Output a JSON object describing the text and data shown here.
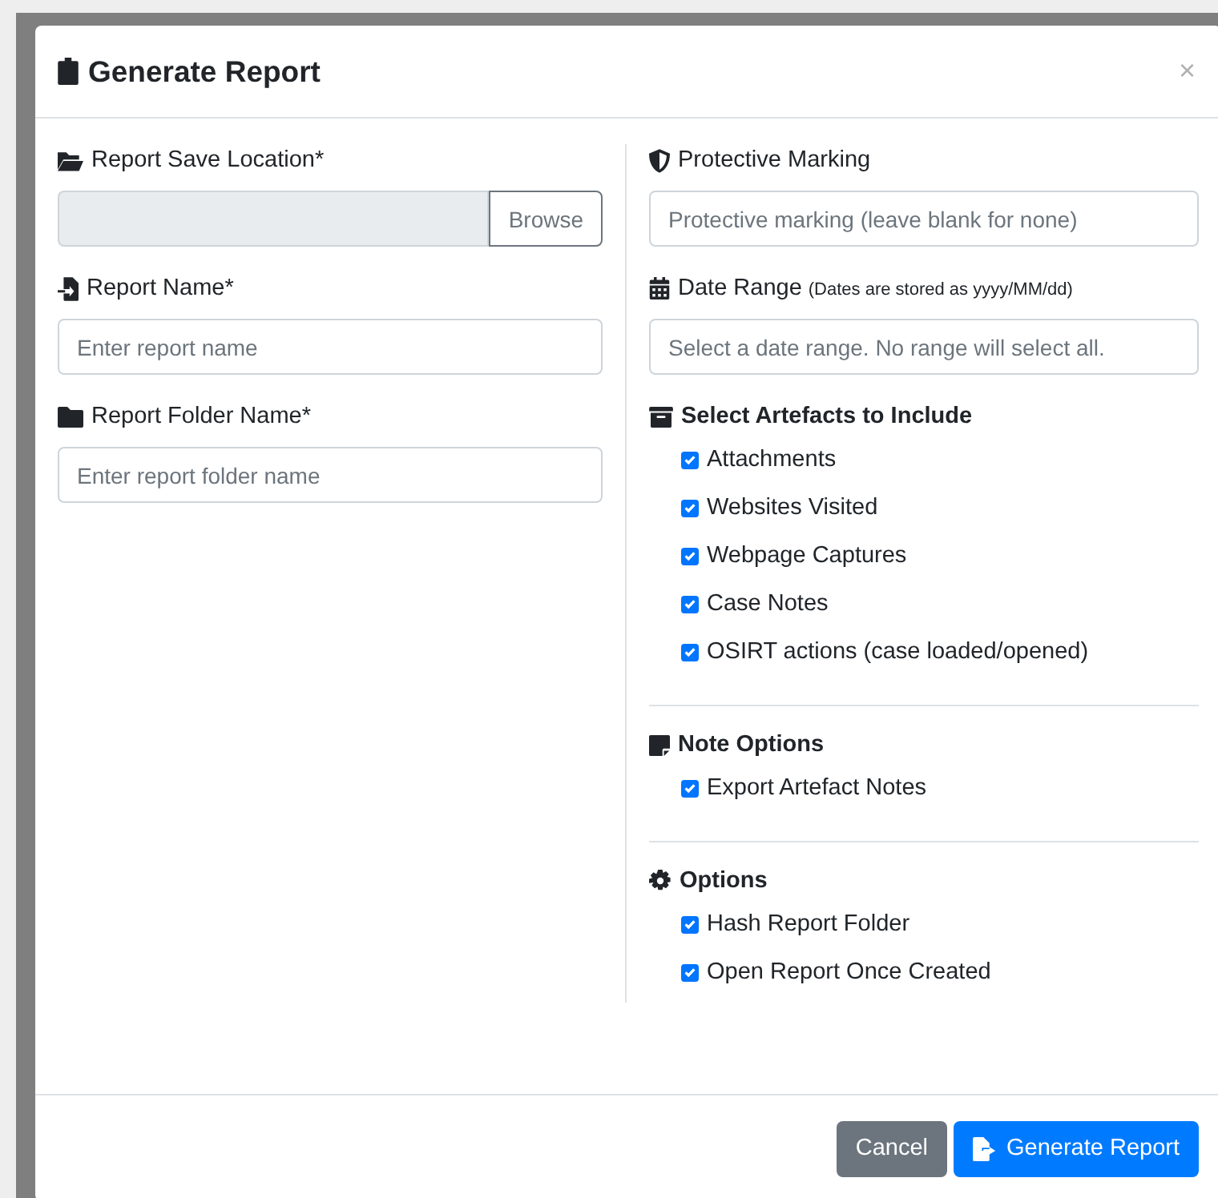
{
  "modal": {
    "title": "Generate Report",
    "close": "×"
  },
  "left_fields": [
    {
      "kind": "browse",
      "label": "Report Save Location*",
      "button": "Browse"
    },
    {
      "kind": "text",
      "label": "Report Name*",
      "placeholder": "Enter report name"
    },
    {
      "kind": "text",
      "label": "Report Folder Name*",
      "placeholder": "Enter report folder name"
    }
  ],
  "right_fields": [
    {
      "label": "Protective Marking",
      "placeholder": "Protective marking (leave blank for none)"
    },
    {
      "label": "Date Range",
      "note": "(Dates are stored as yyyy/MM/dd)",
      "placeholder": "Select a date range. No range will select all."
    }
  ],
  "sections": [
    {
      "title": "Select Artefacts to Include",
      "options": [
        {
          "label": "Attachments",
          "checked": true
        },
        {
          "label": "Websites Visited",
          "checked": true
        },
        {
          "label": "Webpage Captures",
          "checked": true
        },
        {
          "label": "Case Notes",
          "checked": true
        },
        {
          "label": "OSIRT actions (case loaded/opened)",
          "checked": true
        }
      ]
    },
    {
      "title": "Note Options",
      "options": [
        {
          "label": "Export Artefact Notes",
          "checked": true
        }
      ]
    },
    {
      "title": "Options",
      "options": [
        {
          "label": "Hash Report Folder",
          "checked": true
        },
        {
          "label": "Open Report Once Created",
          "checked": true
        }
      ]
    }
  ],
  "buttons": [
    {
      "label": "Cancel",
      "kind": "secondary"
    },
    {
      "label": "Generate Report",
      "kind": "primary"
    }
  ]
}
